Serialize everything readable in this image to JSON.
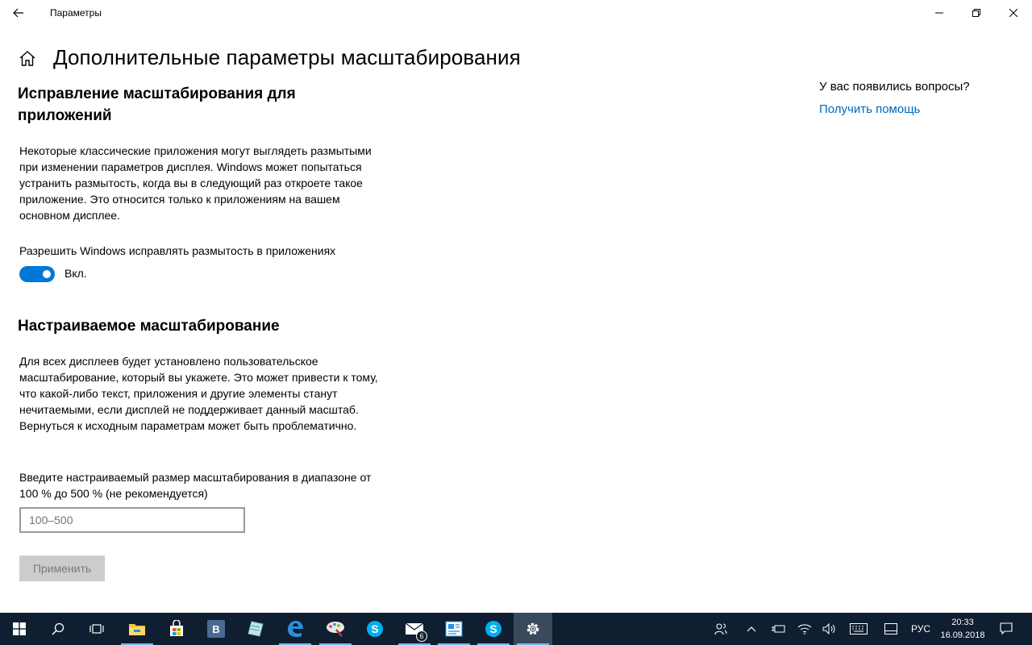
{
  "window": {
    "app_title": "Параметры"
  },
  "header": {
    "page_title": "Дополнительные параметры масштабирования"
  },
  "fix_scaling": {
    "heading": "Исправление масштабирования для приложений",
    "description": "Некоторые классические приложения могут выглядеть размытыми при изменении параметров дисплея. Windows может попытаться устранить размытость, когда вы в следующий раз откроете такое приложение. Это относится только к приложениям на вашем основном дисплее.",
    "toggle_label": "Разрешить Windows исправлять размытость в приложениях",
    "toggle_state": "Вкл.",
    "toggle_on": true
  },
  "custom_scaling": {
    "heading": "Настраиваемое масштабирование",
    "description": "Для всех дисплеев будет установлено пользовательское масштабирование, который вы укажете. Это может привести к тому, что какой-либо текст, приложения и другие элементы станут нечитаемыми, если дисплей не поддерживает данный масштаб. Вернуться к исходным параметрам может быть проблематично.",
    "input_label": "Введите настраиваемый размер масштабирования в диапазоне от 100 % до 500 % (не рекомендуется)",
    "input_value": "",
    "input_placeholder": "100–500",
    "apply_label": "Применить"
  },
  "help": {
    "question": "У вас появились вопросы?",
    "link": "Получить помощь"
  },
  "taskbar": {
    "apps": [
      "start-icon",
      "search-icon",
      "task-view-icon",
      "file-explorer-icon",
      "store-icon",
      "vk-icon",
      "notepad-icon",
      "edge-icon",
      "paint-icon",
      "skype-icon",
      "mail-icon",
      "photos-icon",
      "skype-icon",
      "settings-icon"
    ],
    "mail_badge": "6",
    "language": "РУС",
    "time": "20:33",
    "date": "16.09.2018"
  },
  "colors": {
    "accent": "#0078d7",
    "link": "#0067b8",
    "taskbar": "#0f1e30"
  }
}
